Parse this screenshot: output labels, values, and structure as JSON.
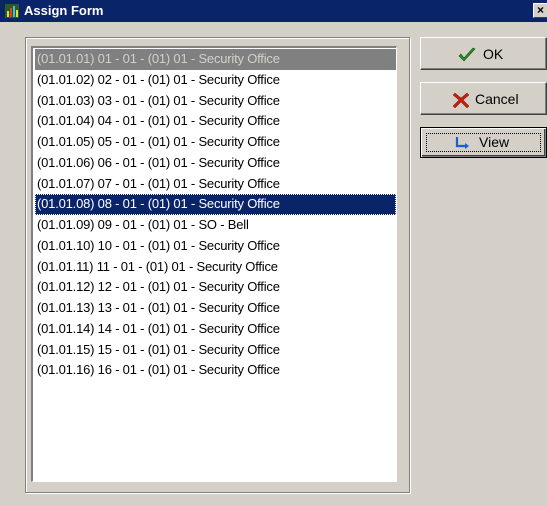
{
  "window": {
    "title": "Assign Form",
    "close_glyph": "×"
  },
  "list": {
    "items": [
      {
        "text": "(01.01.01) 01 - 01 - (01) 01 - Security Office",
        "state": "disabled"
      },
      {
        "text": "(01.01.02) 02 - 01 - (01) 01 - Security Office",
        "state": "normal"
      },
      {
        "text": "(01.01.03) 03 - 01 - (01) 01 - Security Office",
        "state": "normal"
      },
      {
        "text": "(01.01.04) 04 - 01 - (01) 01 - Security Office",
        "state": "normal"
      },
      {
        "text": "(01.01.05) 05 - 01 - (01) 01 - Security Office",
        "state": "normal"
      },
      {
        "text": "(01.01.06) 06 - 01 - (01) 01 - Security Office",
        "state": "normal"
      },
      {
        "text": "(01.01.07) 07 - 01 - (01) 01 - Security Office",
        "state": "normal"
      },
      {
        "text": "(01.01.08) 08 - 01 - (01) 01 - Security Office",
        "state": "selected"
      },
      {
        "text": "(01.01.09) 09 - 01 - (01) 01 - SO - Bell",
        "state": "normal"
      },
      {
        "text": "(01.01.10) 10 - 01 - (01) 01 - Security Office",
        "state": "normal"
      },
      {
        "text": "(01.01.11) 11 - 01 - (01) 01 - Security Office",
        "state": "normal"
      },
      {
        "text": "(01.01.12) 12 - 01 - (01) 01 - Security Office",
        "state": "normal"
      },
      {
        "text": "(01.01.13) 13 - 01 - (01) 01 - Security Office",
        "state": "normal"
      },
      {
        "text": "(01.01.14) 14 - 01 - (01) 01 - Security Office",
        "state": "normal"
      },
      {
        "text": "(01.01.15) 15 - 01 - (01) 01 - Security Office",
        "state": "normal"
      },
      {
        "text": "(01.01.16) 16 - 01 - (01) 01 - Security Office",
        "state": "normal"
      }
    ]
  },
  "buttons": {
    "ok": {
      "label": "OK",
      "icon": "checkmark-icon",
      "color": "#2e8b22"
    },
    "cancel": {
      "label": "Cancel",
      "icon": "x-icon",
      "color": "#c0200e"
    },
    "view": {
      "label": "View",
      "icon": "view-arrow-icon",
      "color": "#1a5fd6"
    }
  },
  "colors": {
    "title_bar": "#0a246a",
    "selection": "#0a246a",
    "face": "#d4d0c8"
  }
}
